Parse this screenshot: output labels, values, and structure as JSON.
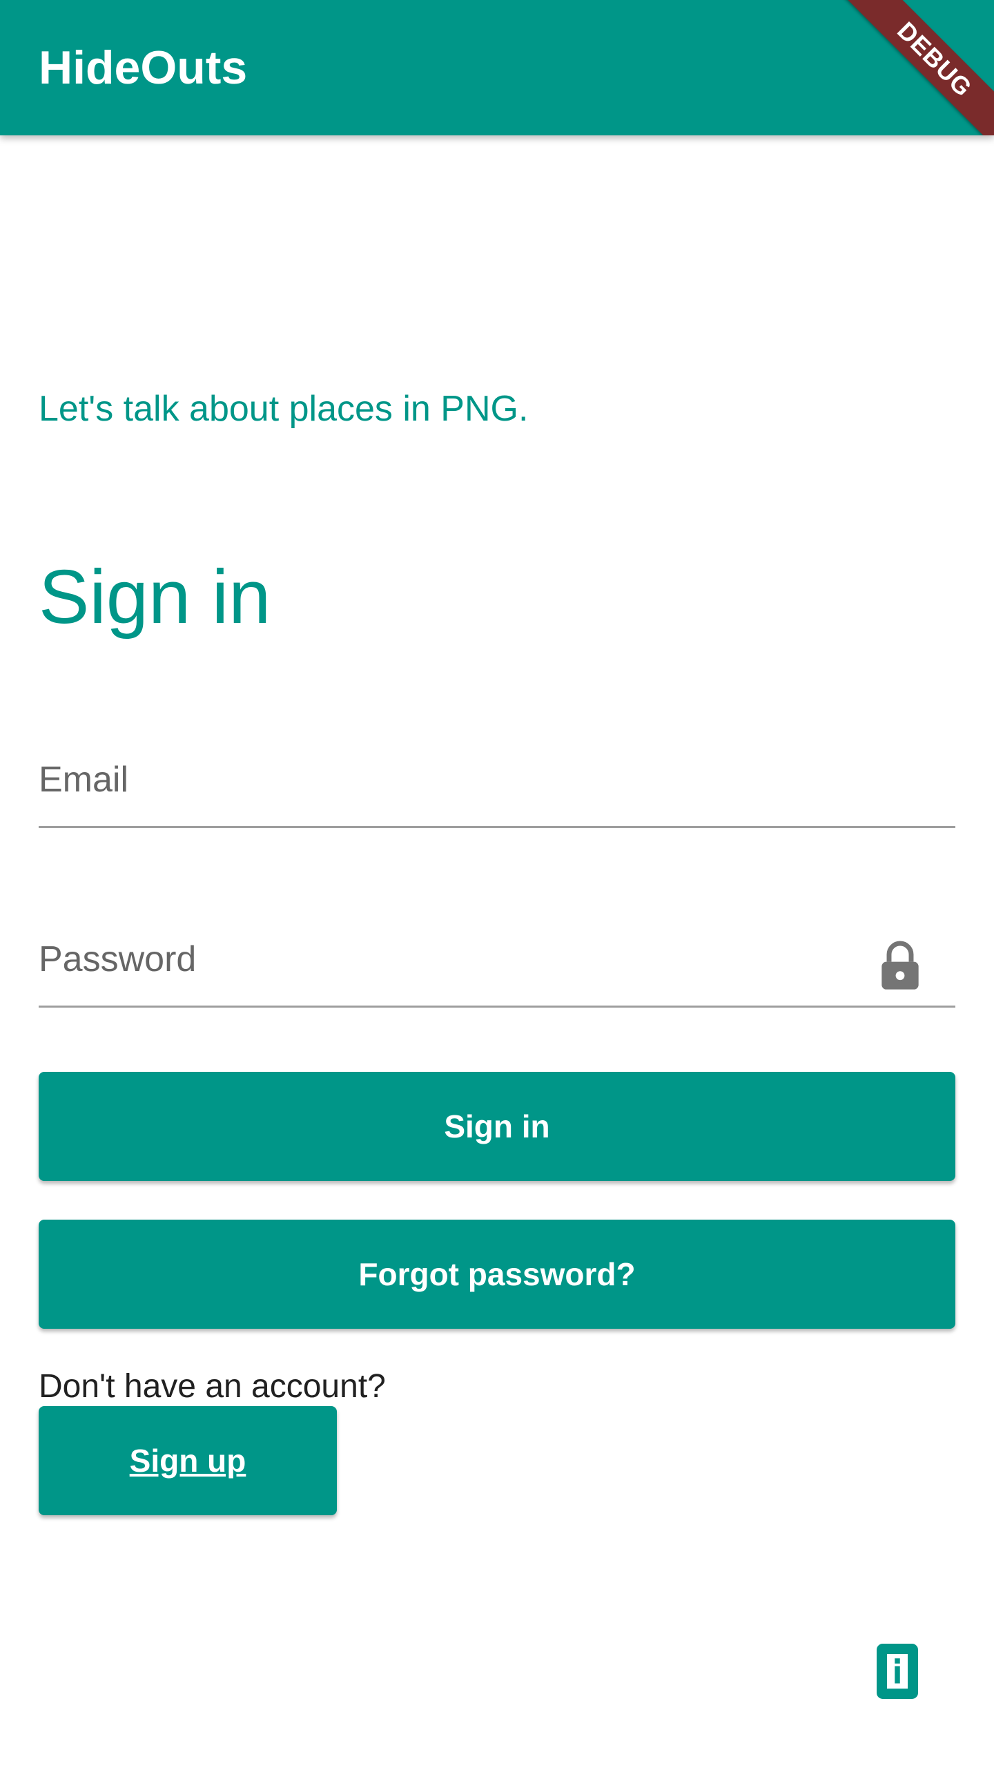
{
  "app": {
    "title": "HideOuts",
    "debug_label": "DEBUG",
    "accent_color": "#009688"
  },
  "main": {
    "tagline": "Let's talk about places in PNG.",
    "heading": "Sign in"
  },
  "form": {
    "email_placeholder": "Email",
    "password_placeholder": "Password",
    "password_icon": "lock-icon"
  },
  "buttons": {
    "sign_in": "Sign in",
    "forgot_password": "Forgot password?",
    "sign_up": "Sign up"
  },
  "footer": {
    "signup_prompt": "Don't have an account?",
    "info_icon": "info-icon"
  }
}
